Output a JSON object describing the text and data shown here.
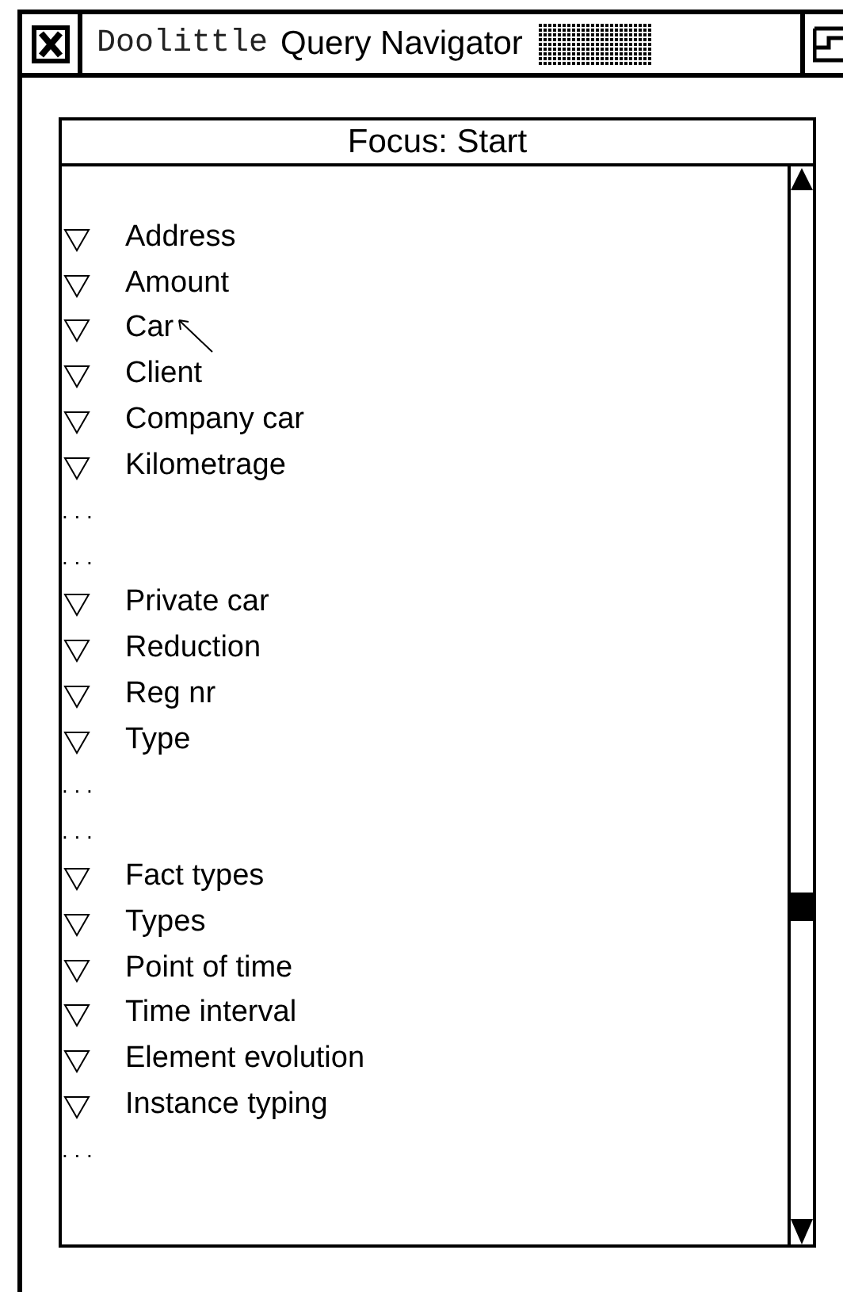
{
  "window": {
    "title_prefix": "Doolittle",
    "title": "Query Navigator"
  },
  "panel": {
    "heading": "Focus: Start",
    "rows": [
      {
        "kind": "item",
        "label": "Address"
      },
      {
        "kind": "item",
        "label": "Amount"
      },
      {
        "kind": "item",
        "label": "Car"
      },
      {
        "kind": "item",
        "label": "Client"
      },
      {
        "kind": "item",
        "label": "Company car"
      },
      {
        "kind": "item",
        "label": "Kilometrage"
      },
      {
        "kind": "ellipsis",
        "label": ". . ."
      },
      {
        "kind": "ellipsis",
        "label": ". . ."
      },
      {
        "kind": "item",
        "label": "Private car"
      },
      {
        "kind": "item",
        "label": "Reduction"
      },
      {
        "kind": "item",
        "label": "Reg nr"
      },
      {
        "kind": "item",
        "label": "Type"
      },
      {
        "kind": "ellipsis",
        "label": ". . ."
      },
      {
        "kind": "ellipsis",
        "label": ". . ."
      },
      {
        "kind": "item",
        "label": "Fact types"
      },
      {
        "kind": "item",
        "label": "Types"
      },
      {
        "kind": "item",
        "label": "Point of time"
      },
      {
        "kind": "item",
        "label": "Time interval"
      },
      {
        "kind": "item",
        "label": "Element evolution"
      },
      {
        "kind": "item",
        "label": "Instance typing"
      },
      {
        "kind": "ellipsis",
        "label": ". . ."
      }
    ]
  }
}
